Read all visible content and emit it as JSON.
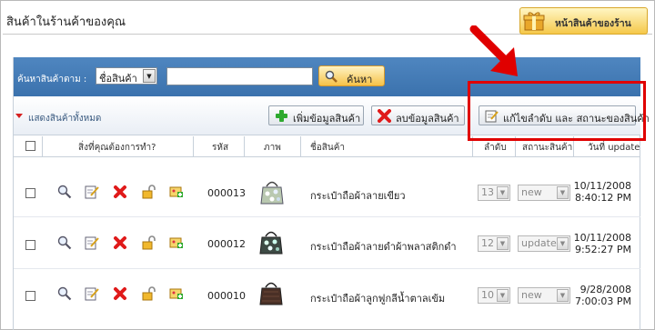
{
  "page": {
    "title": "สินค้าในร้านค้าของคุณ",
    "shop_button": "หน้าสินค้าของร้าน"
  },
  "search": {
    "label": "ค้นหาสินค้าตาม :",
    "field_option": "ชื่อสินค้า",
    "input_value": "",
    "button": "ค้นหา"
  },
  "toolbar": {
    "show_all": "แสดงสินค้าทั้งหมด",
    "add_label": "เพิ่มข้อมูลสินค้า",
    "delete_label": "ลบข้อมูลสินค้า",
    "edit_order_label": "แก้ไขลำดับ และ สถานะของสินค้า"
  },
  "table": {
    "headers": {
      "actions": "สิ่งที่คุณต้องการทำ?",
      "code": "รหัส",
      "image": "ภาพ",
      "name": "ชื่อสินค้า",
      "order": "ลำดับ",
      "status": "สถานะสินค้า",
      "updated": "วันที่ update"
    },
    "rows": [
      {
        "code": "000013",
        "name": "กระเป๋าถือผ้าลายเขียว",
        "order": "13",
        "status": "new",
        "date": "10/11/2008",
        "time": "8:40:12 PM"
      },
      {
        "code": "000012",
        "name": "กระเป๋าถือผ้าลายดำผ้าพลาสติกดำ",
        "order": "12",
        "status": "update",
        "date": "10/11/2008",
        "time": "9:52:27 PM"
      },
      {
        "code": "000010",
        "name": "กระเป๋าถือผ้าลูกฟูกลีน้ำตาลเข้ม",
        "order": "10",
        "status": "new",
        "date": "9/28/2008",
        "time": "7:00:03 PM"
      }
    ]
  },
  "colors": {
    "search_bar": "#3b72ad",
    "accent_yellow": "#f6c247",
    "highlight_red": "#e00000"
  }
}
